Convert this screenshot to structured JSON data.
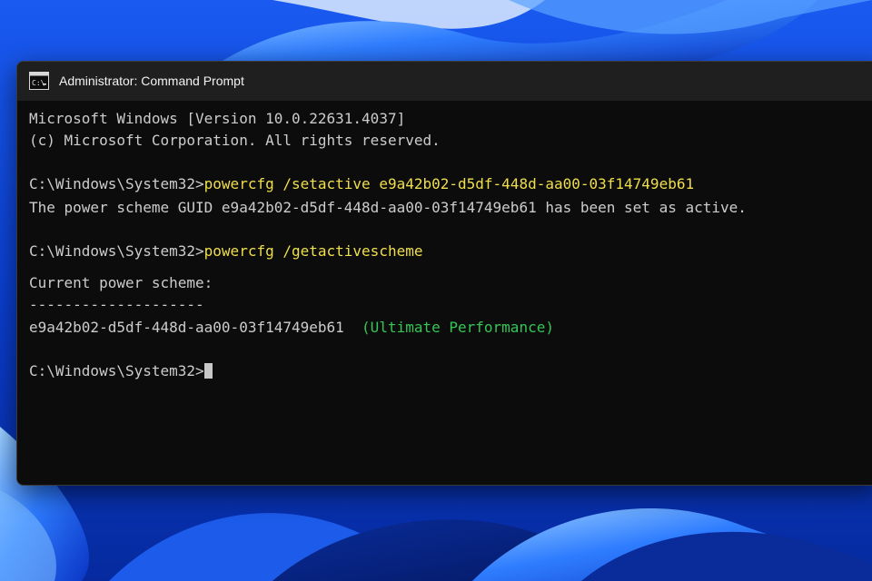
{
  "window": {
    "title": "Administrator: Command Prompt",
    "app_icon": "command-prompt-icon"
  },
  "console": {
    "version_line": "Microsoft Windows [Version 10.0.22631.4037]",
    "copyright_line": "(c) Microsoft Corporation. All rights reserved.",
    "prompt": "C:\\Windows\\System32>",
    "commands": [
      {
        "text": "powercfg /setactive e9a42b02-d5df-448d-aa00-03f14749eb61"
      },
      {
        "text": "powercfg /getactivescheme"
      }
    ],
    "setactive_output": "The power scheme GUID e9a42b02-d5df-448d-aa00-03f14749eb61 has been set as active.",
    "current_scheme_label": "Current power scheme:",
    "separator": "--------------------",
    "scheme_guid": "e9a42b02-d5df-448d-aa00-03f14749eb61",
    "scheme_name": "(Ultimate Performance)"
  },
  "colors": {
    "command_text": "#f0df4c",
    "scheme_name": "#35c655",
    "console_background": "#0c0c0c",
    "titlebar_background": "#1f1f1f",
    "desktop_accent": "#0a3fd6"
  }
}
